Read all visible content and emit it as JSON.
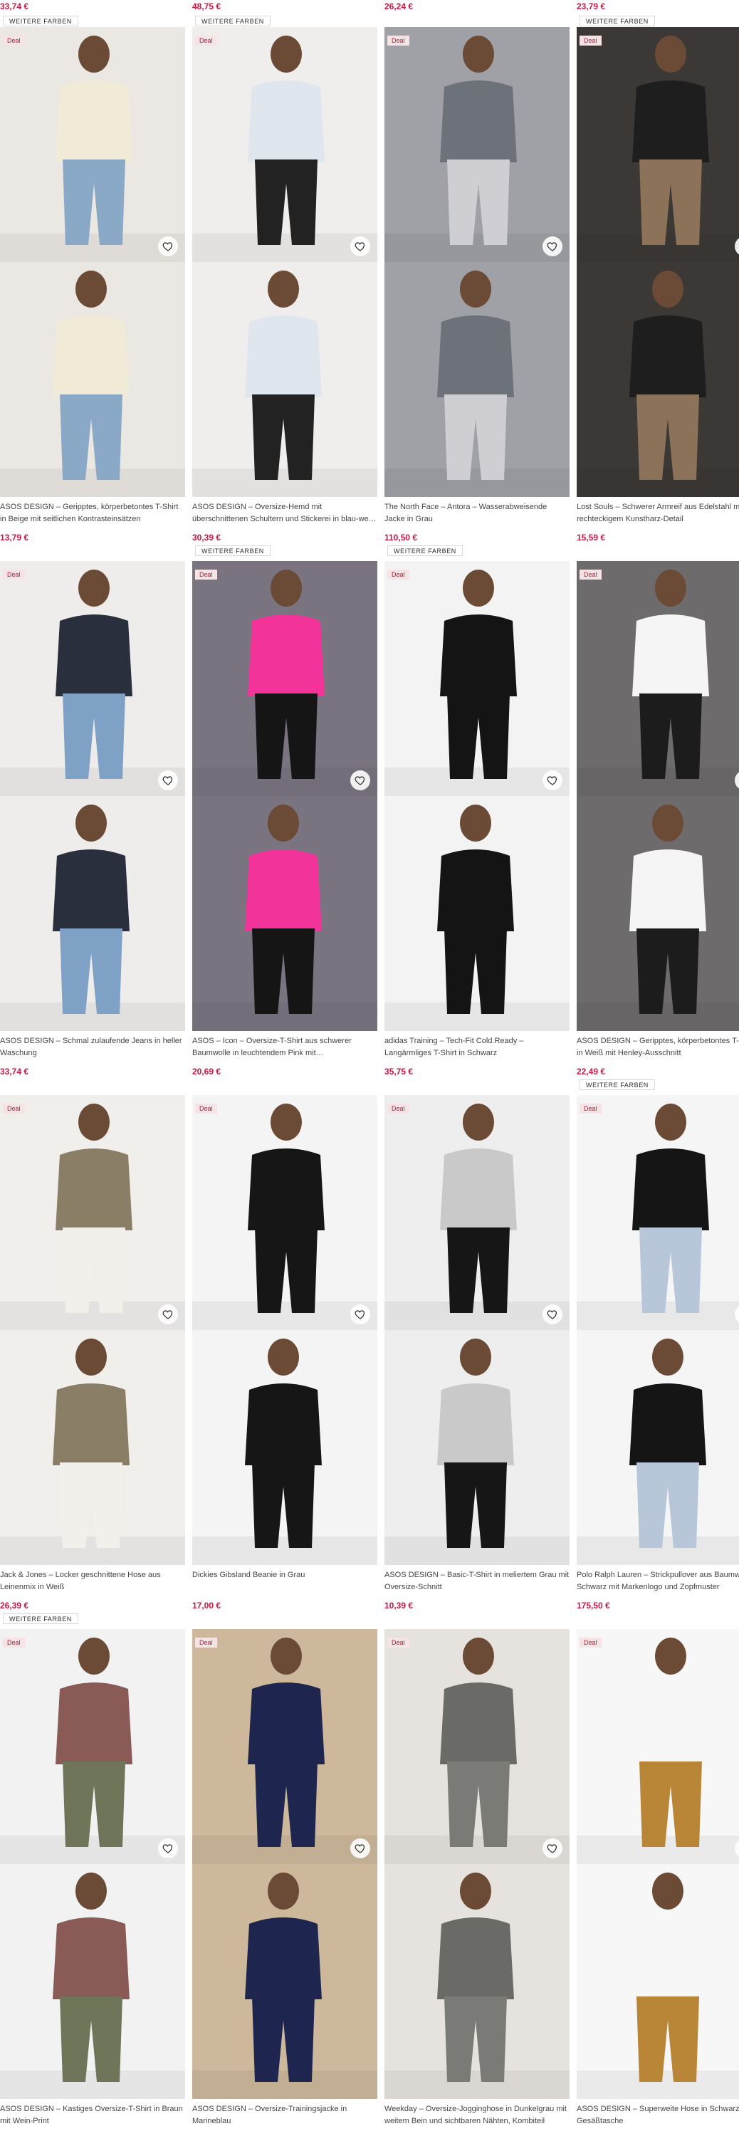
{
  "top_row": [
    {
      "price": "33,74 €",
      "tag": "WEITERE FARBEN"
    },
    {
      "price": "48,75 €",
      "tag": "WEITERE FARBEN"
    },
    {
      "price": "26,24 €",
      "tag": ""
    },
    {
      "price": "23,79 €",
      "tag": "WEITERE FARBEN"
    }
  ],
  "products": [
    {
      "title": "ASOS DESIGN – Geripptes, körperbetontes T-Shirt in Beige mit seitlichen Kontrasteinsätzen",
      "price": "13,79 €",
      "deal": "Deal",
      "tag": "",
      "bg": "#ebe7e2",
      "top": "#f1ead6",
      "bottom": "#8aa9c7"
    },
    {
      "title": "ASOS DESIGN – Oversize-Hemd mit überschnittenen Schultern und Stickerei in blau-we…",
      "price": "30,39 €",
      "deal": "Deal",
      "tag": "WEITERE FARBEN",
      "bg": "#f0eeec",
      "top": "#dfe6ee",
      "bottom": "#222222"
    },
    {
      "title": "The North Face – Antora – Wasserabweisende Jacke in Grau",
      "price": "110,50 €",
      "deal": "Deal",
      "tag": "WEITERE FARBEN",
      "bg": "#9fa1a6",
      "top": "#6d7179",
      "bottom": "#cfcfd3"
    },
    {
      "title": "Lost Souls – Schwerer Armreif aus Edelstahl mit rechteckigem Kunstharz-Detail",
      "price": "15,59 €",
      "deal": "Deal",
      "tag": "",
      "bg": "#3b3836",
      "top": "#1e1e1e",
      "bottom": "#8b7259"
    },
    {
      "title": "ASOS DESIGN – Schmal zulaufende Jeans in heller Waschung",
      "price": "33,74 €",
      "deal": "Deal",
      "tag": "",
      "bg": "#efedeb",
      "top": "#2a2f3d",
      "bottom": "#7fa1c6"
    },
    {
      "title": "ASOS – Icon – Oversize-T-Shirt aus schwerer Baumwolle in leuchtendem Pink mit…",
      "price": "20,69 €",
      "deal": "Deal",
      "tag": "",
      "bg": "#7a7480",
      "top": "#f2339a",
      "bottom": "#151515"
    },
    {
      "title": "adidas Training – Tech-Fit Cold.Ready – Langärmliges T-Shirt in Schwarz",
      "price": "35,75 €",
      "deal": "Deal",
      "tag": "",
      "bg": "#f3f3f3",
      "top": "#141414",
      "bottom": "#141414"
    },
    {
      "title": "ASOS DESIGN – Geripptes, körperbetontes T-Shirt in Weiß mit Henley-Ausschnitt",
      "price": "22,49 €",
      "deal": "Deal",
      "tag": "WEITERE FARBEN",
      "bg": "#6e6b6d",
      "top": "#f5f5f5",
      "bottom": "#1c1c1c"
    },
    {
      "title": "Jack & Jones – Locker geschnittene Hose aus Leinenmix in Weiß",
      "price": "26,39 €",
      "deal": "Deal",
      "tag": "WEITERE FARBEN",
      "bg": "#f1efec",
      "top": "#8a7f66",
      "bottom": "#f2f0ea"
    },
    {
      "title": "Dickies Gibsland Beanie in Grau",
      "price": "17,00 €",
      "deal": "Deal",
      "tag": "",
      "bg": "#f4f4f4",
      "top": "#161616",
      "bottom": "#161616"
    },
    {
      "title": "ASOS DESIGN – Basic-T-Shirt in meliertem Grau mit Oversize-Schnitt",
      "price": "10,39 €",
      "deal": "Deal",
      "tag": "",
      "bg": "#eeeeee",
      "top": "#c9c9c9",
      "bottom": "#161616"
    },
    {
      "title": "Polo Ralph Lauren – Strickpullover aus Baumwolle in Schwarz mit Markenlogo und Zopfmuster",
      "price": "175,50 €",
      "deal": "Deal",
      "tag": "",
      "bg": "#f5f5f5",
      "top": "#151515",
      "bottom": "#b7c7d9"
    },
    {
      "title": "ASOS DESIGN – Kastiges Oversize-T-Shirt in Braun mit Wein-Print",
      "price": "",
      "deal": "Deal",
      "tag": "",
      "bg": "#f2f2f2",
      "top": "#8a5a57",
      "bottom": "#6f7558"
    },
    {
      "title": "ASOS DESIGN – Oversize-Trainingsjacke in Marineblau",
      "price": "",
      "deal": "Deal",
      "tag": "",
      "bg": "#cdb89b",
      "top": "#1e2650",
      "bottom": "#1e2650"
    },
    {
      "title": "Weekday – Oversize-Jogginghose in Dunkelgrau mit weitem Bein und sichtbaren Nähten, Kombiteil",
      "price": "",
      "deal": "Deal",
      "tag": "",
      "bg": "#e6e3df",
      "top": "#6a6a66",
      "bottom": "#7a7a76"
    },
    {
      "title": "ASOS DESIGN – Superweite Hose in Schwarz Gesäßtasche",
      "price": "",
      "deal": "Deal",
      "tag": "",
      "bg": "#f7f7f7",
      "top": "#f7f7f7",
      "bottom": "#b98536"
    }
  ]
}
